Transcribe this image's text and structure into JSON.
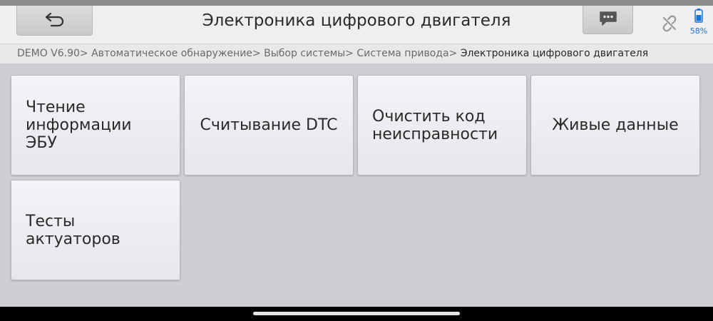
{
  "header": {
    "title": "Электроника цифрового двигателя",
    "back_icon": "back-arrow-icon",
    "message_icon": "message-icon",
    "connection_icon": "link-broken-icon",
    "battery_icon": "battery-icon",
    "battery_level": "58%"
  },
  "breadcrumb": {
    "items": [
      "DEMO V6.90>",
      "Автоматическое обнаружение>",
      "Выбор системы>",
      "Система привода>",
      "Электроника цифрового двигателя"
    ]
  },
  "menu": {
    "items": [
      {
        "label": "Чтение информации ЭБУ"
      },
      {
        "label": "Считывание DTC"
      },
      {
        "label": "Очистить код неисправности"
      },
      {
        "label": "Живые данные"
      },
      {
        "label": "Тесты актуаторов"
      }
    ]
  },
  "colors": {
    "background": "#cfcfd3",
    "header": "#efeff1",
    "battery_accent": "#1a73d6",
    "tile": "#eceef2"
  }
}
